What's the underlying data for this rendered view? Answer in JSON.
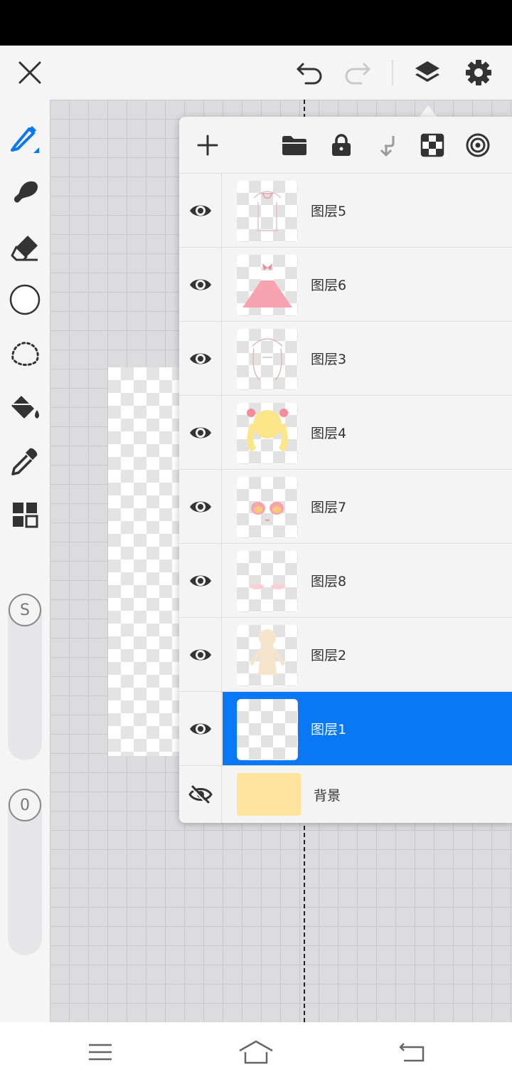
{
  "layers_panel": {
    "layers": [
      {
        "name": "图层5",
        "visible": true,
        "selected": false
      },
      {
        "name": "图层6",
        "visible": true,
        "selected": false
      },
      {
        "name": "图层3",
        "visible": true,
        "selected": false
      },
      {
        "name": "图层4",
        "visible": true,
        "selected": false
      },
      {
        "name": "图层7",
        "visible": true,
        "selected": false
      },
      {
        "name": "图层8",
        "visible": true,
        "selected": false
      },
      {
        "name": "图层2",
        "visible": true,
        "selected": false
      },
      {
        "name": "图层1",
        "visible": true,
        "selected": true
      }
    ],
    "background": {
      "name": "背景",
      "visible": false,
      "color": "#fde39b"
    }
  },
  "sidebar": {
    "brush_size_label": "S",
    "opacity_label": "0"
  },
  "colors": {
    "accent": "#0a78f5",
    "brush_color": "#ffffff"
  },
  "icons": {
    "topbar": [
      "close-icon",
      "undo-icon",
      "redo-icon",
      "layers-icon",
      "settings-icon"
    ],
    "tools": [
      "pen-icon",
      "smudge-icon",
      "eraser-icon",
      "color-swatch",
      "lasso-icon",
      "fill-bucket-icon",
      "eyedropper-icon",
      "grid-icon"
    ],
    "panel_toolbar": [
      "add-icon",
      "folder-icon",
      "lock-icon",
      "merge-down-icon",
      "transparency-icon",
      "target-icon"
    ],
    "bottom_nav": [
      "menu-icon",
      "home-icon",
      "back-icon"
    ]
  }
}
